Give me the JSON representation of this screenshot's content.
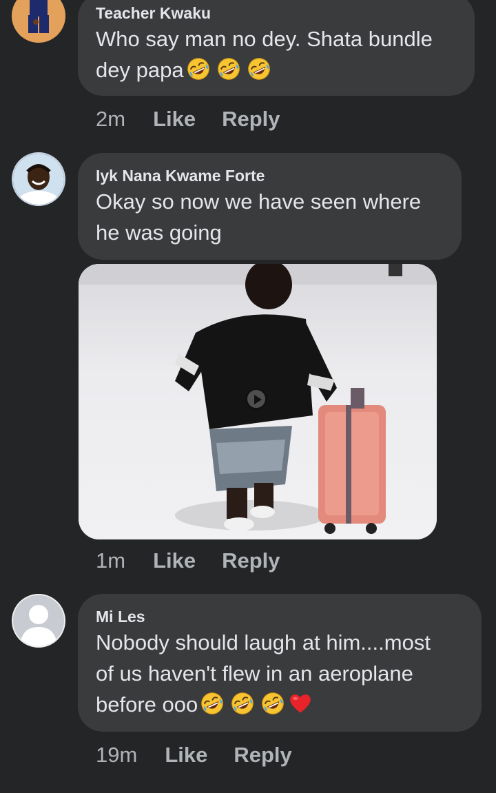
{
  "comments": [
    {
      "author": "Teacher Kwaku",
      "text_line1": "Who say man no dey. Shata bundle",
      "text_line2": "dey papa",
      "emojis": [
        "rolling-on-floor-laughing",
        "rolling-on-floor-laughing",
        "rolling-on-floor-laughing"
      ],
      "time": "2m",
      "like_label": "Like",
      "reply_label": "Reply"
    },
    {
      "author": "Iyk Nana Kwame Forte",
      "text_line1": "Okay so now we have seen where",
      "text_line2": "he was going",
      "attachment": "video",
      "time": "1m",
      "like_label": "Like",
      "reply_label": "Reply"
    },
    {
      "author": "Mi Les",
      "text_line1": "Nobody should laugh at him....most",
      "text_line2": "of us haven't flew in an aeroplane",
      "text_line3": "before ooo",
      "emojis": [
        "rolling-on-floor-laughing",
        "rolling-on-floor-laughing",
        "rolling-on-floor-laughing",
        "red-heart"
      ],
      "time": "19m",
      "like_label": "Like",
      "reply_label": "Reply"
    }
  ],
  "colors": {
    "background": "#242526",
    "bubble": "#3a3b3c",
    "text": "#e4e6eb",
    "secondary_text": "#b0b3b8"
  }
}
